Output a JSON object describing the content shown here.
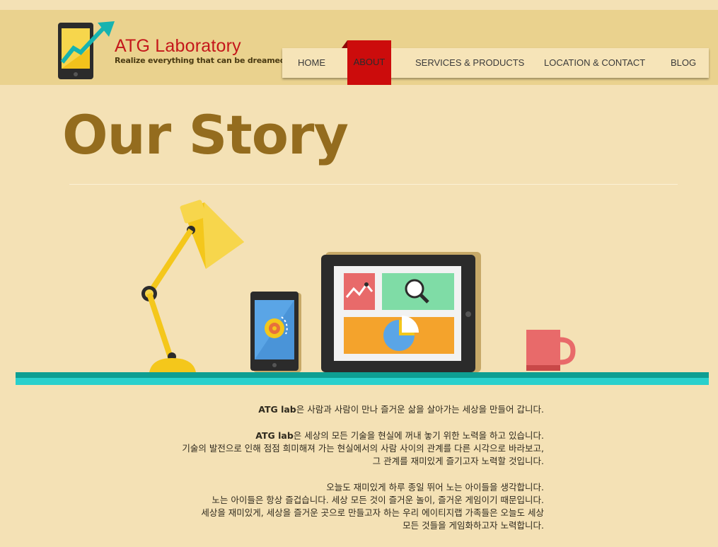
{
  "brand": {
    "title": "ATG Laboratory",
    "tagline": "Realize everything that can be dreamed"
  },
  "nav": {
    "items": [
      {
        "label": "HOME",
        "active": false
      },
      {
        "label": "ABOUT",
        "active": true
      },
      {
        "label": "SERVICES & PRODUCTS",
        "active": false
      },
      {
        "label": "LOCATION & CONTACT",
        "active": false
      },
      {
        "label": "BLOG",
        "active": false
      }
    ]
  },
  "page": {
    "title": "Our Story"
  },
  "story": {
    "p1": {
      "bold": "ATG lab",
      "text": "은 사람과 사람이 만나 즐거운 삶을 살아가는 세상을 만들어 갑니다."
    },
    "p2_l1": {
      "bold": "ATG lab",
      "text": "은 세상의 모든 기술을 현실에 꺼내 놓기 위한 노력을 하고 있습니다."
    },
    "p2_l2": "기술의 발전으로 인해 점점 희미해져 가는 현실에서의 사람 사이의  관계를 다른 시각으로 바라보고,",
    "p2_l3": "그 관계를 재미있게 즐기고자 노력할 것입니다.",
    "p3_l1": "오늘도 재미있게 하루 종일 뛰어 노는 아이들을 생각합니다.",
    "p3_l2": "노는 아이들은 항상 즐겁습니다. 세상 모든 것이 즐거운 놀이, 즐거운 게임이기 때문입니다.",
    "p3_l3": "세상을 재미있게, 세상을 즐거운 곳으로 만들고자 하는 우리 에이티지랩 가족들은 오늘도 세상",
    "p3_l4": "모든 것들을 게임화하고자 노력합니다."
  },
  "colors": {
    "header_bg": "#ead28e",
    "page_bg": "#f4e1b5",
    "brand_red": "#c4171b",
    "active_nav": "#cc0c0c",
    "title_brown": "#946c1e",
    "shelf_teal": "#29d0cc"
  },
  "icons": {
    "logo": "phone-growth-arrow-icon",
    "illustration": "desk-lamp-phone-tablet-mug"
  }
}
